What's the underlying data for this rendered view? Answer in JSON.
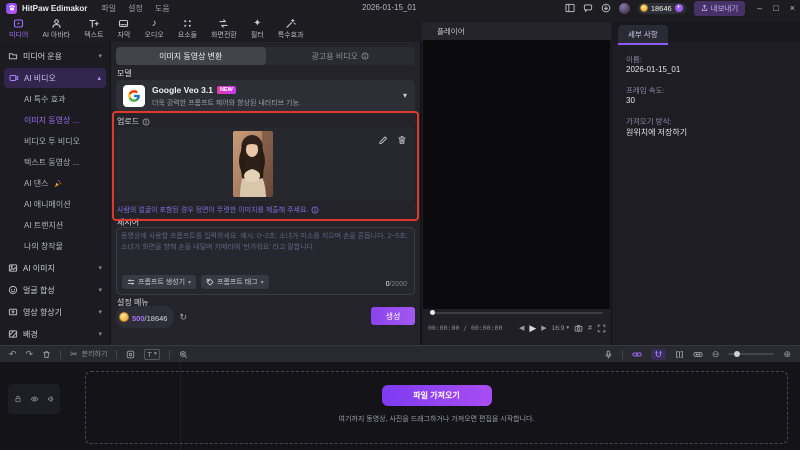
{
  "colors": {
    "accent": "#8b5cf6",
    "annotation_red": "#e0392b",
    "generate_gradient": [
      "#8a42ee",
      "#a358f2"
    ],
    "new_badge": "#d83bd0",
    "hint_purple": "#7f70d8"
  },
  "icons": {
    "caret_down": "▾",
    "caret_up": "▴",
    "play": "▶",
    "step_back": "◀",
    "step_forward": "▶",
    "undo": "↶",
    "redo": "↷",
    "scissors": "✂",
    "refresh": "↻",
    "zoom_in": "⊕",
    "zoom_out": "⊖",
    "minimize": "–",
    "maximize": "□",
    "close": "×",
    "note": "♪",
    "sparkle": "✦",
    "grid": "#",
    "plus": "+",
    "text_tool": "T",
    "info": "i"
  },
  "titlebar": {
    "app_name": "HitPaw Edimakor",
    "menu_file": "파일",
    "menu_settings": "설정",
    "menu_help": "도움",
    "document_title": "2026-01-15_01",
    "credits": "18646",
    "export_label": "내보내기"
  },
  "toolbar": {
    "tabs": [
      {
        "label": "미디어"
      },
      {
        "label": "AI 아바타"
      },
      {
        "label": "텍스트"
      },
      {
        "label": "자막"
      },
      {
        "label": "오디오"
      },
      {
        "label": "요소들"
      },
      {
        "label": "화면전환"
      },
      {
        "label": "필터"
      },
      {
        "label": "특수효과"
      }
    ]
  },
  "sidebar": {
    "group_media": "미디어 운용",
    "group_ai_video": "AI 비디오",
    "items": [
      {
        "label": "AI 특수 효과"
      },
      {
        "label": "이미지 동영상 ..."
      },
      {
        "label": "비디오 투 비디오"
      },
      {
        "label": "텍스트 동영상 ..."
      },
      {
        "label": "AI 댄스"
      },
      {
        "label": "AI 애니메이션"
      },
      {
        "label": "AI 트랜지션"
      },
      {
        "label": "나의 창작물"
      }
    ],
    "group_ai_image": "AI 이미지",
    "group_face_swap": "얼굴 합성",
    "group_enhancer": "영상 향상기",
    "group_background": "배경"
  },
  "main": {
    "tab_image_to_video": "이미지 동영상 변환",
    "tab_ad_video": "광고용 비디오",
    "model_label": "모델",
    "model_name": "Google Veo 3.1",
    "model_badge": "NEW",
    "model_desc": "더욱 강력한 프롬프트 제어와 향상된 내러티브 기능.",
    "upload_label": "업로드",
    "upload_hint": "사람의 얼굴이 포함된 경우 정면이 뚜렷한 이미지를 제출해 주세요.",
    "prompt_label": "제시어",
    "prompt_placeholder": "동영상에 사용할 프롬프트를 입력하세요. 예시: 0~2초: 소녀가 미소를 지으며 손을 흔듭니다. 2~5초: 소녀가 화면을 향해 손을 내밀며 카메라에 '반가워요' 라고 말합니다.",
    "prompt_generator": "프롬프트 생성기",
    "prompt_tags": "프롬프트 태그",
    "char_counter_current": "0",
    "char_counter_max": "/2000",
    "settings_label": "설정 메뉴",
    "cost_current": "500",
    "cost_total": "/18646",
    "generate_label": "생성"
  },
  "player": {
    "title": "플레이어",
    "timecode": "00:00:00 / 00:00:00",
    "aspect_ratio": "16:9"
  },
  "details": {
    "tab_label": "세부 사항",
    "name_label": "이름:",
    "name_value": "2026-01-15_01",
    "fps_label": "프레임 속도:",
    "fps_value": "30",
    "import_label": "가져오기 방식:",
    "import_value": "원위치에 저장하기"
  },
  "timeline": {
    "split_label": "분리하기",
    "import_button_label": "파일 가져오기",
    "drop_hint": "여기까지 동영상, 사진을 드래그하거나 가져오면 편집을 시작합니다."
  }
}
